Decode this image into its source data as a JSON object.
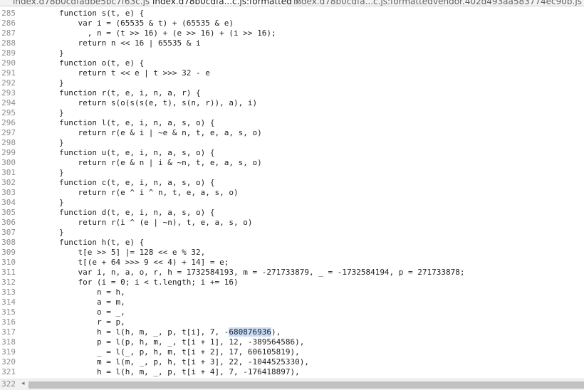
{
  "tabs": [
    {
      "label": "index.d78b0cdfadbe5bc7f63c.js",
      "active": false
    },
    {
      "label": "index.d78b0cdfa...c.js:formatted",
      "active": true,
      "close": "×"
    },
    {
      "label": "index.d78b0cdfa...c.js:formatted",
      "active": false
    },
    {
      "label": "vendor.402d493aa583774ec90b.js",
      "active": false
    }
  ],
  "editor": {
    "lines": [
      {
        "n": "285",
        "text": "        function s(t, e) {"
      },
      {
        "n": "286",
        "text": "            var i = (65535 & t) + (65535 & e)"
      },
      {
        "n": "287",
        "text": "              , n = (t >> 16) + (e >> 16) + (i >> 16);"
      },
      {
        "n": "288",
        "text": "            return n << 16 | 65535 & i"
      },
      {
        "n": "289",
        "text": "        }"
      },
      {
        "n": "290",
        "text": "        function o(t, e) {"
      },
      {
        "n": "291",
        "text": "            return t << e | t >>> 32 - e"
      },
      {
        "n": "292",
        "text": "        }"
      },
      {
        "n": "293",
        "text": "        function r(t, e, i, n, a, r) {"
      },
      {
        "n": "294",
        "text": "            return s(o(s(s(e, t), s(n, r)), a), i)"
      },
      {
        "n": "295",
        "text": "        }"
      },
      {
        "n": "296",
        "text": "        function l(t, e, i, n, a, s, o) {"
      },
      {
        "n": "297",
        "text": "            return r(e & i | ~e & n, t, e, a, s, o)"
      },
      {
        "n": "298",
        "text": "        }"
      },
      {
        "n": "299",
        "text": "        function u(t, e, i, n, a, s, o) {"
      },
      {
        "n": "300",
        "text": "            return r(e & n | i & ~n, t, e, a, s, o)"
      },
      {
        "n": "301",
        "text": "        }"
      },
      {
        "n": "302",
        "text": "        function c(t, e, i, n, a, s, o) {"
      },
      {
        "n": "303",
        "text": "            return r(e ^ i ^ n, t, e, a, s, o)"
      },
      {
        "n": "304",
        "text": "        }"
      },
      {
        "n": "305",
        "text": "        function d(t, e, i, n, a, s, o) {"
      },
      {
        "n": "306",
        "text": "            return r(i ^ (e | ~n), t, e, a, s, o)"
      },
      {
        "n": "307",
        "text": "        }"
      },
      {
        "n": "308",
        "text": "        function h(t, e) {"
      },
      {
        "n": "309",
        "text": "            t[e >> 5] |= 128 << e % 32,"
      },
      {
        "n": "310",
        "text": "            t[(e + 64 >>> 9 << 4) + 14] = e;"
      },
      {
        "n": "311",
        "text": "            var i, n, a, o, r, h = 1732584193, m = -271733879, _ = -1732584194, p = 271733878;"
      },
      {
        "n": "312",
        "text": "            for (i = 0; i < t.length; i += 16)"
      },
      {
        "n": "313",
        "text": "                n = h,"
      },
      {
        "n": "314",
        "text": "                a = m,"
      },
      {
        "n": "315",
        "text": "                o = _,"
      },
      {
        "n": "316",
        "text": "                r = p,"
      },
      {
        "n": "317",
        "pre": "                h = l(h, m, _, p, t[i], 7, -",
        "hl": "680876936",
        "post": "),"
      },
      {
        "n": "318",
        "text": "                p = l(p, h, m, _, t[i + 1], 12, -389564586),"
      },
      {
        "n": "319",
        "text": "                _ = l(_, p, h, m, t[i + 2], 17, 606105819),"
      },
      {
        "n": "320",
        "text": "                m = l(m, _, p, h, t[i + 3], 22, -1044525330),"
      },
      {
        "n": "321",
        "text": "                h = l(h, m, _, p, t[i + 4], 7, -176418897),"
      }
    ],
    "last_line_number": "322"
  },
  "scrollbar": {
    "left_arrow": "◂"
  }
}
